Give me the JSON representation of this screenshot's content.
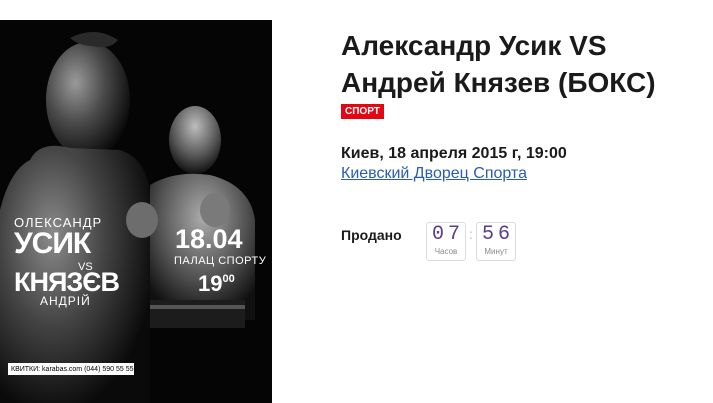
{
  "poster": {
    "first_name_1": "ОЛЕКСАНДР",
    "last_name_1": "УСИК",
    "vs": "VS",
    "last_name_2": "КНЯЗЄВ",
    "first_name_2": "АНДРІЙ",
    "date": "18.04",
    "venue": "ПАЛАЦ СПОРТУ",
    "time_hours": "19",
    "time_minutes": "00",
    "tickets_strip": "КВИТКИ: karabas.com  (044) 590 55 55"
  },
  "event": {
    "title": "Александр Усик VS Андрей Князев (БОКС)",
    "category_badge": "СПОРТ",
    "datetime": "Киев, 18 апреля 2015 г, 19:00",
    "venue_link": "Киевский Дворец Спорта",
    "colors": {
      "badge": "#e30613",
      "link": "#2a5db0",
      "timer_digits": "#5a3c8a"
    }
  },
  "sold": {
    "label": "Продано",
    "hours_value": "07",
    "hours_unit": "Часов",
    "separator": ":",
    "minutes_value": "56",
    "minutes_unit": "Минут"
  }
}
